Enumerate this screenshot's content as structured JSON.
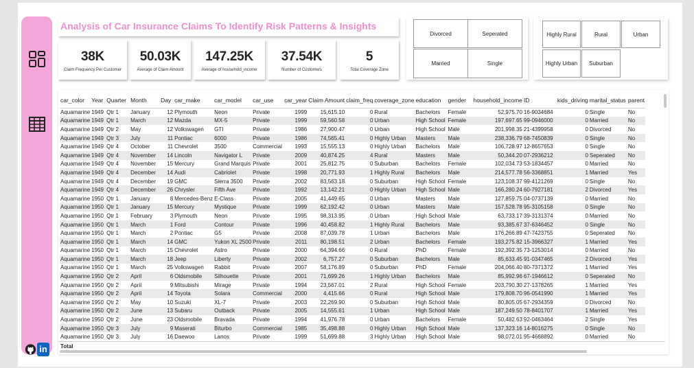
{
  "title": "Analysis of Car Insurance  Claims To Identify Risk Patterns & Insights",
  "colors": {
    "accent": "#f4a6d8",
    "title": "#f08fcf",
    "linkedin": "#0a66c2"
  },
  "sidebar": {
    "icons": [
      "dashboard-icon",
      "table-grid-icon",
      "github-icon",
      "linkedin-icon"
    ],
    "linkedin_text": "in"
  },
  "kpis": [
    {
      "value": "38K",
      "label": "Claim Frequency Per Customer"
    },
    {
      "value": "50.03K",
      "label": "Average of Claim Amount"
    },
    {
      "value": "147.25K",
      "label": "Average of household_income"
    },
    {
      "value": "37.54K",
      "label": "Number of Customers"
    },
    {
      "value": "5",
      "label": "Total Coverage Zone"
    }
  ],
  "marital_slicer": [
    "Divorced",
    "Seperated",
    "Married",
    "Single"
  ],
  "zone_slicer": [
    "Highly Rural",
    "Rural",
    "Urban",
    "Highly Urban",
    "Suburban"
  ],
  "table": {
    "columns": [
      "car_color",
      "Year",
      "Quarter",
      "Month",
      "Day",
      "car_make",
      "car_model",
      "car_use",
      "car_year",
      "Claim Amount",
      "claim_freq",
      "coverage_zone",
      "education",
      "gender",
      "household_income",
      "ID",
      "kids_driving",
      "marital_status",
      "parent"
    ],
    "rows": [
      [
        "Aquamarine",
        "1949",
        "Qtr 1",
        "January",
        "12",
        "Plymouth",
        "Neon",
        "Private",
        "1999",
        "15,615.10",
        "0",
        "Rural",
        "Bachelors",
        "Female",
        "52,975.70",
        "16-9034684",
        "0",
        "Single",
        "No"
      ],
      [
        "Aquamarine",
        "1949",
        "Qtr 1",
        "March",
        "12",
        "Mazda",
        "MX-5",
        "Private",
        "1999",
        "59,560.58",
        "0",
        "Urban",
        "High School",
        "Female",
        "197,697.65",
        "99-0946000",
        "0",
        "Married",
        "No"
      ],
      [
        "Aquamarine",
        "1949",
        "Qtr 2",
        "May",
        "12",
        "Volkswagen",
        "GTI",
        "Private",
        "1986",
        "27,900.47",
        "0",
        "Urban",
        "High School",
        "Male",
        "201,998.35",
        "21-4399958",
        "0",
        "Divorced",
        "No"
      ],
      [
        "Aquamarine",
        "1949",
        "Qtr 3",
        "July",
        "11",
        "Pontiac",
        "6000",
        "Private",
        "1986",
        "74,565.41",
        "0",
        "Highly Urban",
        "Masters",
        "Male",
        "238,336.79",
        "68-7450839",
        "0",
        "Single",
        "No"
      ],
      [
        "Aquamarine",
        "1949",
        "Qtr 4",
        "October",
        "11",
        "Chevrolet",
        "3500",
        "Commercial",
        "1993",
        "15,555.13",
        "0",
        "Highly Urban",
        "Bachelors",
        "Male",
        "106,728.97",
        "12-8657653",
        "0",
        "Single",
        "No"
      ],
      [
        "Aquamarine",
        "1949",
        "Qtr 4",
        "November",
        "14",
        "Lincoln",
        "Navigator L",
        "Private",
        "2009",
        "40,874.25",
        "4",
        "Rural",
        "Masters",
        "Male",
        "50,344.20",
        "07-2936212",
        "0",
        "Seperated",
        "No"
      ],
      [
        "Aquamarine",
        "1949",
        "Qtr 4",
        "November",
        "15",
        "Mercury",
        "Grand Marquis",
        "Private",
        "2001",
        "25,812.75",
        "0",
        "Suburban",
        "Bachelors",
        "Female",
        "102,034.73",
        "53-1834457",
        "0",
        "Married",
        "No"
      ],
      [
        "Aquamarine",
        "1949",
        "Qtr 4",
        "December",
        "14",
        "Audi",
        "Cabriolet",
        "Private",
        "1998",
        "20,771.93",
        "1",
        "Highly Rural",
        "Bachelors",
        "Male",
        "214,577.78",
        "56-3368851",
        "1",
        "Married",
        "Yes"
      ],
      [
        "Aquamarine",
        "1949",
        "Qtr 4",
        "December",
        "19",
        "GMC",
        "Sierra 3500",
        "Private",
        "2002",
        "83,563.18",
        "0",
        "Suburban",
        "High School",
        "Female",
        "123,108.37",
        "99-4121269",
        "0",
        "Single",
        "No"
      ],
      [
        "Aquamarine",
        "1949",
        "Qtr 4",
        "December",
        "26",
        "Chrysler",
        "Fifth Ave",
        "Private",
        "1992",
        "13,142.21",
        "0",
        "Highly Urban",
        "High School",
        "Male",
        "166,280.24",
        "60-7927181",
        "2",
        "Divorced",
        "Yes"
      ],
      [
        "Aquamarine",
        "1950",
        "Qtr 1",
        "January",
        "8",
        "Mercedes-Benz",
        "E-Class",
        "Private",
        "2005",
        "41,449.65",
        "0",
        "Urban",
        "Masters",
        "Male",
        "127,859.75",
        "04-0737139",
        "0",
        "Married",
        "No"
      ],
      [
        "Aquamarine",
        "1950",
        "Qtr 1",
        "January",
        "15",
        "Mercury",
        "Mystique",
        "Private",
        "1999",
        "62,192.42",
        "0",
        "Urban",
        "Masters",
        "Male",
        "157,528.78",
        "95-3105158",
        "0",
        "Single",
        "No"
      ],
      [
        "Aquamarine",
        "1950",
        "Qtr 1",
        "February",
        "3",
        "Plymouth",
        "Neon",
        "Private",
        "1995",
        "98,313.95",
        "0",
        "Urban",
        "High School",
        "Male",
        "63,733.17",
        "39-3131374",
        "0",
        "Married",
        "No"
      ],
      [
        "Aquamarine",
        "1950",
        "Qtr 1",
        "March",
        "1",
        "Ford",
        "Contour",
        "Private",
        "1996",
        "40,458.82",
        "1",
        "Highly Rural",
        "Bachelors",
        "Male",
        "93,385.67",
        "37-6346452",
        "0",
        "Single",
        "No"
      ],
      [
        "Aquamarine",
        "1950",
        "Qtr 1",
        "March",
        "2",
        "Pontiac",
        "G5",
        "Private",
        "2008",
        "87,039.78",
        "1",
        "Urban",
        "Bachelors",
        "Male",
        "176,266.89",
        "47-7423755",
        "0",
        "Seperated",
        "No"
      ],
      [
        "Aquamarine",
        "1950",
        "Qtr 1",
        "March",
        "14",
        "GMC",
        "Yukon XL 2500",
        "Private",
        "2011",
        "80,198.51",
        "2",
        "Urban",
        "Bachelors",
        "Female",
        "193,275.82",
        "15-3966327",
        "1",
        "Married",
        "Yes"
      ],
      [
        "Aquamarine",
        "1950",
        "Qtr 1",
        "March",
        "15",
        "Chevrolet",
        "Astro",
        "Private",
        "2000",
        "64,394.66",
        "0",
        "Rural",
        "PhD",
        "Female",
        "192,392.35",
        "73-1253014",
        "0",
        "Married",
        "No"
      ],
      [
        "Aquamarine",
        "1950",
        "Qtr 1",
        "March",
        "18",
        "Jeep",
        "Liberty",
        "Private",
        "2002",
        "6,757.27",
        "0",
        "Suburban",
        "Bachelors",
        "Male",
        "85,633.45",
        "91-0347465",
        "2",
        "Divorced",
        "Yes"
      ],
      [
        "Aquamarine",
        "1950",
        "Qtr 1",
        "March",
        "25",
        "Volkswagen",
        "Rabbit",
        "Private",
        "2007",
        "58,176.89",
        "0",
        "Suburban",
        "PhD",
        "Female",
        "204,066.40",
        "80-7371372",
        "1",
        "Married",
        "Yes"
      ],
      [
        "Aquamarine",
        "1950",
        "Qtr 2",
        "April",
        "6",
        "Oldsmobile",
        "Silhouette",
        "Private",
        "2001",
        "71,699.26",
        "1",
        "Highly Urban",
        "Bachelors",
        "Male",
        "85,992.96",
        "67-1946612",
        "0",
        "Seperated",
        "No"
      ],
      [
        "Aquamarine",
        "1950",
        "Qtr 2",
        "April",
        "9",
        "Mitsubishi",
        "Mirage",
        "Private",
        "1994",
        "23,567.01",
        "2",
        "Rural",
        "High School",
        "Female",
        "203,790.30",
        "27-1378265",
        "1",
        "Married",
        "Yes"
      ],
      [
        "Aquamarine",
        "1950",
        "Qtr 2",
        "April",
        "14",
        "Toyota",
        "Solara",
        "Commercial",
        "2000",
        "4,415.66",
        "0",
        "Rural",
        "High School",
        "Male",
        "179,808.70",
        "96-0541990",
        "1",
        "Married",
        "Yes"
      ],
      [
        "Aquamarine",
        "1950",
        "Qtr 2",
        "May",
        "10",
        "Suzuki",
        "XL-7",
        "Private",
        "2003",
        "22,269.90",
        "0",
        "Suburban",
        "High School",
        "Male",
        "80,805.05",
        "67-2934359",
        "0",
        "Divorced",
        "No"
      ],
      [
        "Aquamarine",
        "1950",
        "Qtr 2",
        "June",
        "13",
        "Subaru",
        "Outback",
        "Private",
        "2005",
        "14,555.61",
        "1",
        "Urban",
        "High School",
        "Male",
        "187,249.50",
        "78-8401707",
        "1",
        "Married",
        "Yes"
      ],
      [
        "Aquamarine",
        "1950",
        "Qtr 2",
        "June",
        "23",
        "Oldsmobile",
        "Bravada",
        "Private",
        "1994",
        "41,976.78",
        "0",
        "Urban",
        "Bachelors",
        "Female",
        "50,482.63",
        "92-0463464",
        "2",
        "Single",
        "Yes"
      ],
      [
        "Aquamarine",
        "1950",
        "Qtr 3",
        "July",
        "9",
        "Maserati",
        "Biturbo",
        "Commercial",
        "1985",
        "35,498.88",
        "0",
        "Highly Urban",
        "High School",
        "Male",
        "137,323.16",
        "14-8016275",
        "0",
        "Single",
        "No"
      ],
      [
        "Aquamarine",
        "1950",
        "Qtr 3",
        "July",
        "16",
        "Daewoo",
        "Lanos",
        "Private",
        "1999",
        "51,699.88",
        "3",
        "Highly Urban",
        "High School",
        "Male",
        "98,072.01",
        "95-4668892",
        "0",
        "Married",
        "No"
      ]
    ],
    "total_label": "Total"
  }
}
